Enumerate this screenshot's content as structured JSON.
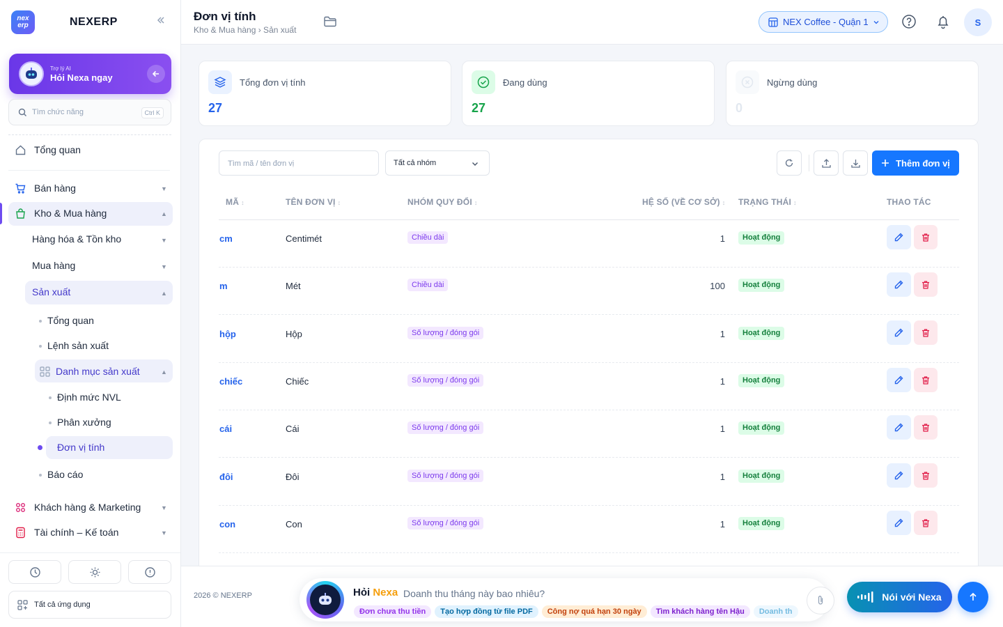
{
  "sidebar": {
    "logo_text": "nex erp",
    "brand": "NEXERP",
    "ai": {
      "small": "Trợ lý AI",
      "title": "Hỏi Nexa ngay"
    },
    "search": {
      "placeholder": "Tìm chức năng",
      "shortcut": "Ctrl K"
    },
    "items": [
      {
        "label": "Tổng quan"
      },
      {
        "label": "Bán hàng"
      },
      {
        "label": "Kho & Mua hàng"
      },
      {
        "label": "Hàng hóa & Tồn kho"
      },
      {
        "label": "Mua hàng"
      },
      {
        "label": "Sản xuất"
      },
      {
        "label": "Tổng quan"
      },
      {
        "label": "Lệnh sản xuất"
      },
      {
        "label": "Danh mục sản xuất"
      },
      {
        "label": "Định mức NVL"
      },
      {
        "label": "Phân xưởng"
      },
      {
        "label": "Đơn vị tính"
      },
      {
        "label": "Báo cáo"
      },
      {
        "label": "Khách hàng & Marketing"
      },
      {
        "label": "Tài chính – Kế toán"
      }
    ],
    "all_apps": "Tất cả ứng dụng"
  },
  "header": {
    "title": "Đơn vị tính",
    "breadcrumb": "Kho & Mua hàng › Sản xuất",
    "branch": "NEX Coffee - Quận 1",
    "avatar": "S"
  },
  "stats": [
    {
      "label": "Tổng đơn vị tính",
      "value": "27",
      "color": "#2563eb"
    },
    {
      "label": "Đang dùng",
      "value": "27",
      "color": "#16a34a"
    },
    {
      "label": "Ngừng dùng",
      "value": "0",
      "color": "#d1d5db"
    }
  ],
  "toolbar": {
    "search_placeholder": "Tìm mã / tên đơn vị",
    "group_select": "Tất cả nhóm",
    "add_label": "Thêm đơn vị"
  },
  "table": {
    "columns": [
      "MÃ",
      "TÊN ĐƠN VỊ",
      "NHÓM QUY ĐỔI",
      "HỆ SỐ (VỀ CƠ SỞ)",
      "TRẠNG THÁI",
      "THAO TÁC"
    ],
    "rows": [
      {
        "code": "cm",
        "name": "Centimét",
        "group": "Chiều dài",
        "coef": "1",
        "status": "Hoạt động"
      },
      {
        "code": "m",
        "name": "Mét",
        "group": "Chiều dài",
        "coef": "100",
        "status": "Hoạt động"
      },
      {
        "code": "hộp",
        "name": "Hộp",
        "group": "Số lượng / đóng gói",
        "coef": "1",
        "status": "Hoạt động"
      },
      {
        "code": "chiếc",
        "name": "Chiếc",
        "group": "Số lượng / đóng gói",
        "coef": "1",
        "status": "Hoạt động"
      },
      {
        "code": "cái",
        "name": "Cái",
        "group": "Số lượng / đóng gói",
        "coef": "1",
        "status": "Hoạt động"
      },
      {
        "code": "đôi",
        "name": "Đôi",
        "group": "Số lượng / đóng gói",
        "coef": "1",
        "status": "Hoạt động"
      },
      {
        "code": "con",
        "name": "Con",
        "group": "Số lượng / đóng gói",
        "coef": "1",
        "status": "Hoạt động"
      }
    ]
  },
  "footer": {
    "copyright": "2026 © NEXERP",
    "ask_prefix": "Hỏi",
    "ask_name": "Nexa",
    "ask_question": "Doanh thu tháng này bao nhiêu?",
    "chips": [
      {
        "label": "Đơn chưa thu tiền",
        "bg": "#f3e8ff",
        "fg": "#9333ea"
      },
      {
        "label": "Tạo hợp đồng từ file PDF",
        "bg": "#e0f2fe",
        "fg": "#0369a1"
      },
      {
        "label": "Công nợ quá hạn 30 ngày",
        "bg": "#ffedd5",
        "fg": "#c2410c"
      },
      {
        "label": "Tìm khách hàng tên Hậu",
        "bg": "#f3e8ff",
        "fg": "#7e22ce"
      },
      {
        "label": "Doanh th",
        "bg": "#e0f2fe",
        "fg": "#0284c7"
      }
    ],
    "voice_label": "Nói với Nexa"
  }
}
